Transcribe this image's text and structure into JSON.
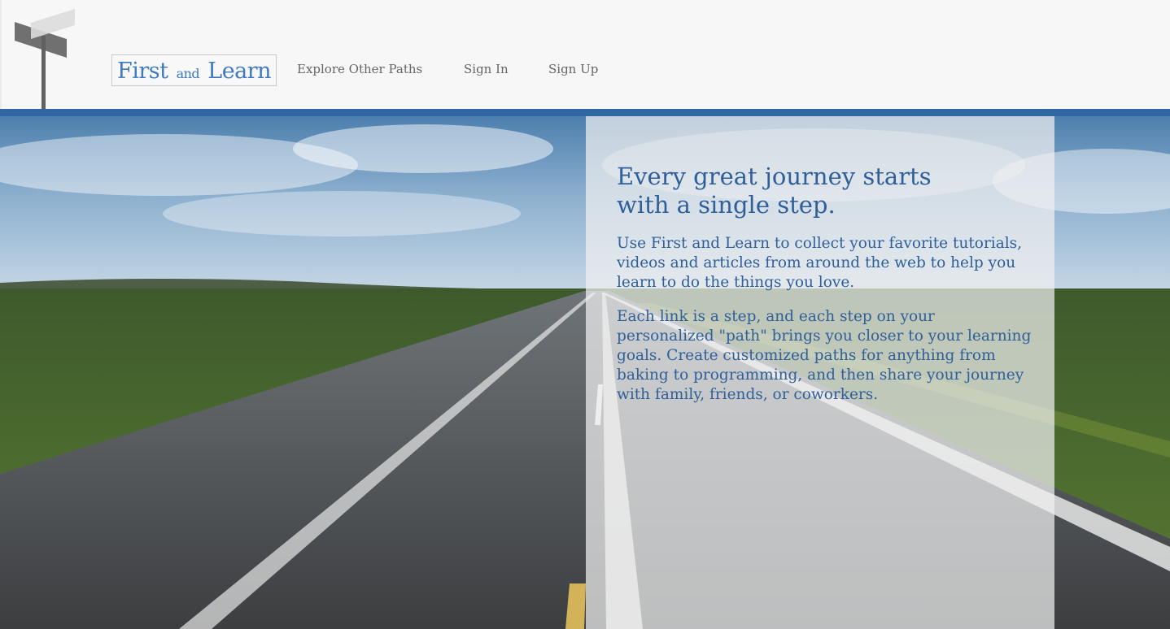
{
  "header": {
    "logo": {
      "first": "First",
      "and": "and",
      "learn": "Learn"
    },
    "nav": {
      "explore": "Explore Other Paths",
      "sign_in": "Sign In",
      "sign_up": "Sign Up"
    }
  },
  "hero": {
    "headline_line1": "Every great journey starts",
    "headline_line2": "with a single step.",
    "paragraph1": "Use First and Learn to collect your favorite tutorials, videos and articles from around the web to help you learn to do the things you love.",
    "paragraph2": "Each link is a step, and each step on your personalized \"path\" brings you closer to your learning goals. Create customized paths for anything from baking to programming, and then share your journey with family, friends, or coworkers."
  },
  "colors": {
    "accent_bar": "#2f67a3",
    "brand_blue": "#3f7ac0",
    "panel_text": "#2f5f99",
    "nav_text": "#666666"
  }
}
